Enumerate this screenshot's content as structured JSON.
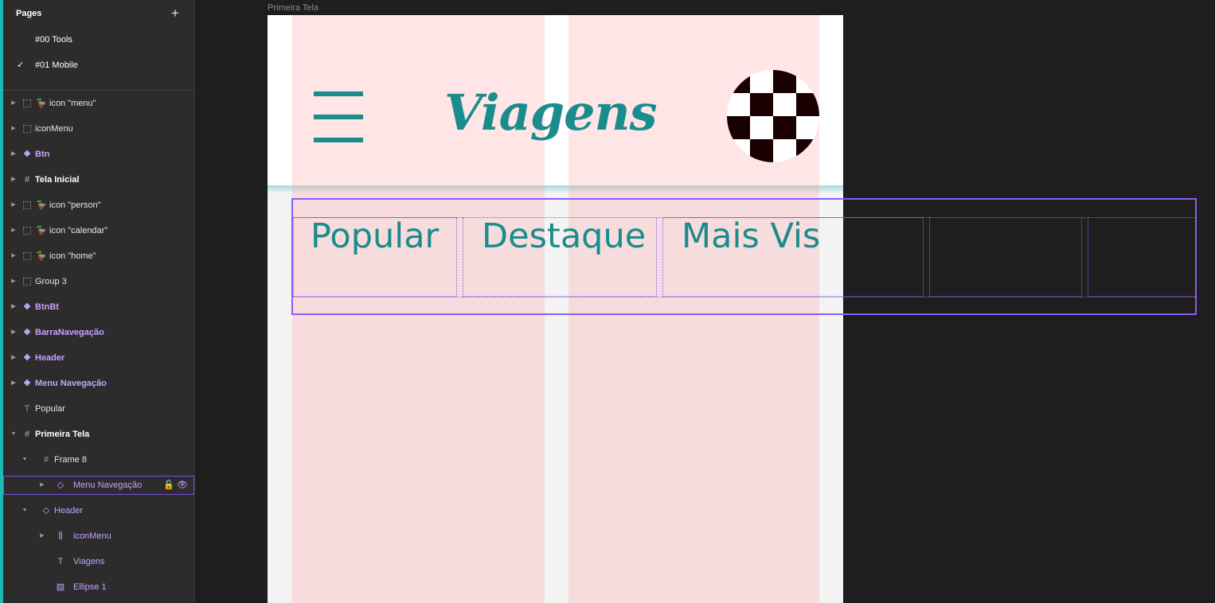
{
  "sidebar": {
    "pages_title": "Pages",
    "pages": [
      {
        "label": "#00 Tools",
        "checked": false
      },
      {
        "label": "#01 Mobile",
        "checked": true
      }
    ],
    "layers": [
      {
        "label": "icon \"menu\"",
        "kind": "plain",
        "icon": "dotted-frame-icon",
        "emoji": "🦆"
      },
      {
        "label": "iconMenu",
        "kind": "plain",
        "icon": "dotted-frame-icon"
      },
      {
        "label": "Btn",
        "kind": "comp",
        "icon": "component-icon"
      },
      {
        "label": "Tela Inicial",
        "kind": "frame",
        "icon": "frame-icon"
      },
      {
        "label": "icon \"person\"",
        "kind": "plain",
        "icon": "dotted-frame-icon",
        "emoji": "🦆"
      },
      {
        "label": "icon \"calendar\"",
        "kind": "plain",
        "icon": "dotted-frame-icon",
        "emoji": "🦆"
      },
      {
        "label": "icon \"home\"",
        "kind": "plain",
        "icon": "dotted-frame-icon",
        "emoji": "🦆"
      },
      {
        "label": "Group 3",
        "kind": "plain",
        "icon": "dotted-frame-icon"
      },
      {
        "label": "BtnBt",
        "kind": "comp",
        "icon": "component-icon"
      },
      {
        "label": "BarraNavegação",
        "kind": "comp",
        "icon": "component-icon"
      },
      {
        "label": "Header",
        "kind": "comp",
        "icon": "component-icon"
      },
      {
        "label": "Menu Navegação",
        "kind": "comp",
        "icon": "component-icon"
      },
      {
        "label": "Popular",
        "kind": "plain",
        "icon": "text-icon"
      },
      {
        "label": "Primeira Tela",
        "kind": "frame",
        "icon": "frame-icon"
      },
      {
        "label": "Frame 8",
        "kind": "plain",
        "icon": "frame-icon"
      },
      {
        "label": "Menu Navegação",
        "kind": "child",
        "icon": "instance-icon",
        "selected": true
      },
      {
        "label": "Header",
        "kind": "child",
        "icon": "instance-icon"
      },
      {
        "label": "iconMenu",
        "kind": "child",
        "icon": "autolayout-icon"
      },
      {
        "label": "Viagens",
        "kind": "child",
        "icon": "text-icon"
      },
      {
        "label": "Ellipse 1",
        "kind": "child",
        "icon": "image-icon"
      }
    ]
  },
  "canvas": {
    "frame_label": "Primeira Tela",
    "logo": "Viagens",
    "tabs": [
      "Popular",
      "Destaque",
      "Mais Vis"
    ]
  },
  "colors": {
    "brand": "#1a8c8c",
    "selection": "#8b5cf6",
    "avatar": "#1a0000"
  }
}
